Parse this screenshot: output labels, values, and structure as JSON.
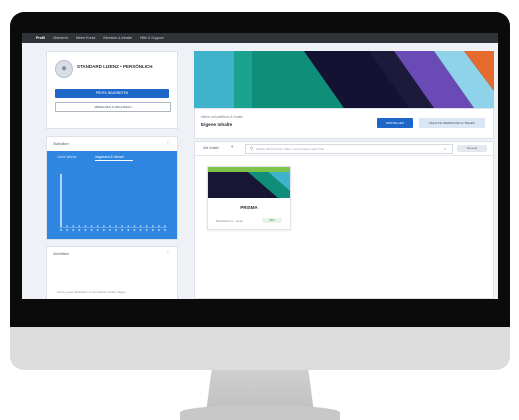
{
  "topnav": {
    "brand": "Profil",
    "items": [
      "Übersicht",
      "Meine Kurse",
      "Bereiche & Inhalte",
      "Hilfe & Support"
    ]
  },
  "profile": {
    "name": "STANDARD LIZENZ • PERSÖNLICH",
    "primary_button": "PROFIL BEARBEITEN",
    "secondary_button": "ABMELDEN & WECHSELN"
  },
  "stats": {
    "title": "Statistiken",
    "tab_a": "Letzte Woche",
    "tab_b": "Insgesamt & Verlauf",
    "chart_data": {
      "type": "bar",
      "values": [
        62,
        2,
        2,
        2,
        2,
        2,
        2,
        2,
        2,
        2,
        2,
        2,
        2,
        2,
        2,
        2,
        2,
        2
      ],
      "ylim": [
        0,
        70
      ]
    }
  },
  "activity": {
    "title": "Aktivitäten",
    "empty_text": "Keine neuen Aktivitäten in den letzten sieben Tagen"
  },
  "header": {
    "subtitle": "Meine Lernplattform & Inhalte",
    "title": "Eigene Inhalte",
    "btn_primary": "ERSTELLEN",
    "btn_secondary": "INHALTE VERWALTEN & TEILEN"
  },
  "toolbar": {
    "filter_label": "Alle Inhalte",
    "search_placeholder": "Inhalte durchsuchen, filtern und sortieren nach Titel",
    "sort_label": "Neueste"
  },
  "item": {
    "name": "PRISMA",
    "meta": "Bearbeitet am · heute",
    "badge": "Aktiv"
  },
  "colors": {
    "primary": "#1f66c9",
    "stats_panel": "#2f86e0",
    "banner_teal": "#1aa38f",
    "banner_purple": "#6a4bb6",
    "banner_orange": "#e46a2d"
  }
}
